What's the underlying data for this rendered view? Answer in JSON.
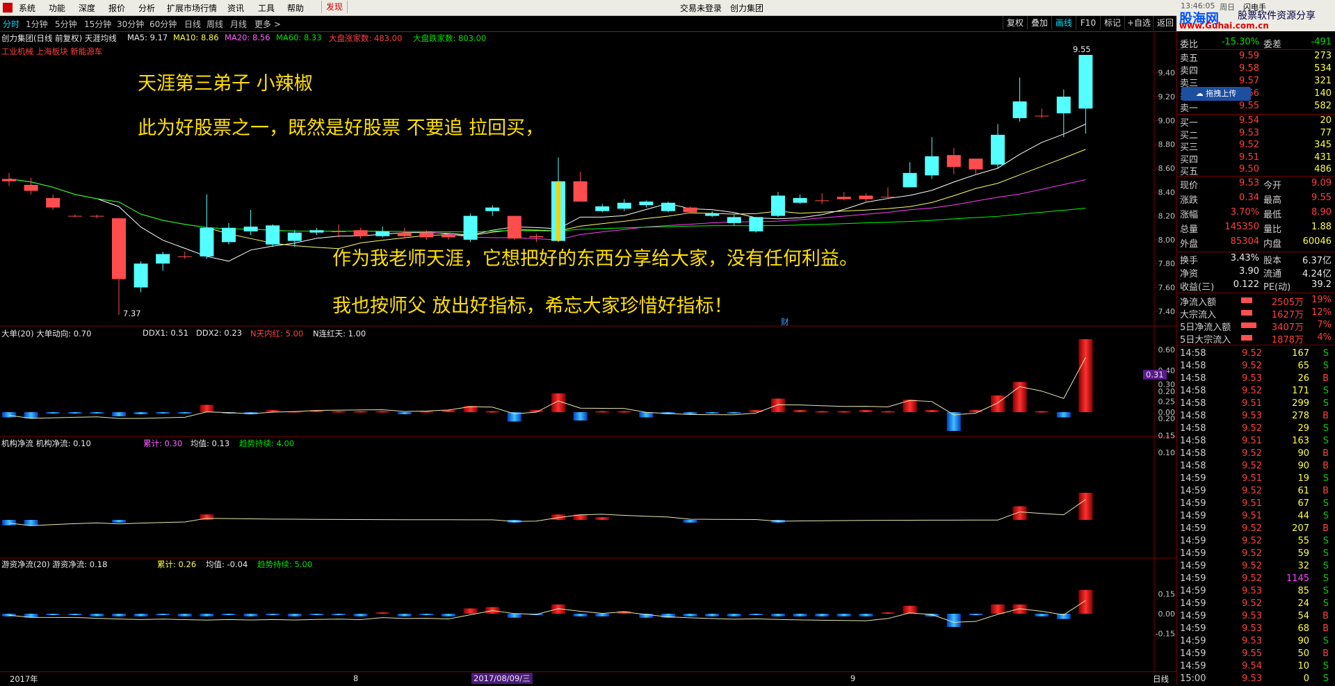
{
  "menu": [
    "系统",
    "功能",
    "深度",
    "报价",
    "分析",
    "扩展市场行情",
    "资讯",
    "工具",
    "帮助",
    "发现"
  ],
  "header_center": [
    "交易未登录",
    "创力集团"
  ],
  "header_right": {
    "time": "13:46:05",
    "week": "周日",
    "flash": "闪电手"
  },
  "logo": {
    "brand": "股海网",
    "slogan": "股票软件资源分享",
    "url": "www.Guhai.com.cn",
    "upload": "拖拽上传"
  },
  "periods": [
    "分时",
    "1分钟",
    "5分钟",
    "15分钟",
    "30分钟",
    "60分钟",
    "日线",
    "周线",
    "月线",
    "更多 >"
  ],
  "toolbar": [
    "复权",
    "叠加",
    "画线",
    "F10",
    "标记",
    "+自选",
    "返回"
  ],
  "main_legend": {
    "title": "创力集团(日线 前复权) 天涯均线",
    "ma5": "MA5: 9.17",
    "ma10": "MA10: 8.86",
    "ma20": "MA20: 8.56",
    "ma60": "MA60: 8.33",
    "up": "大盘涨家数: 483.00",
    "down": "大盘跌家数: 803.00",
    "sector": "工业机械 上海板块 新能源车"
  },
  "annotations": [
    "天涯第三弟子 小辣椒",
    "此为好股票之一，既然是好股票 不要追 拉回买，",
    "作为我老师天涯，它想把好的东西分享给大家，没有任何利益。",
    "我也按师父 放出好指标，希忘大家珍惜好指标！"
  ],
  "price_axis": [
    "9.40",
    "9.20",
    "9.00",
    "8.80",
    "8.60",
    "8.40",
    "8.20",
    "8.00",
    "7.80",
    "7.60",
    "7.40"
  ],
  "high_label": "9.55",
  "low_label": "7.37",
  "cai_marker": "财",
  "pane2": {
    "title": "大单(20) 大单动向: 0.70",
    "ddx1": "DDX1: 0.51",
    "ddx2": "DDX2: 0.23",
    "n1": "N天内红: 5.00",
    "n2": "N连红天: 1.00",
    "axis": [
      "0.60",
      "0.40",
      "0.20",
      "0.00"
    ],
    "tag": "0.31"
  },
  "pane3": {
    "title": "机构净流 机构净流: 0.10",
    "sum": "累计: 0.30",
    "avg": "均值: 0.13",
    "trend": "趋势持续: 4.00",
    "axis": [
      "0.30",
      "0.25",
      "0.20",
      "0.15",
      "0.10"
    ]
  },
  "pane4": {
    "title": "游资净流(20) 游资净流: 0.18",
    "sum": "累计: 0.26",
    "avg": "均值: -0.04",
    "trend": "趋势持续: 5.00",
    "axis": [
      "0.15",
      "0.00",
      "-0.15"
    ]
  },
  "date_axis": {
    "left": "2017年",
    "m8": "8",
    "cursor": "2017/08/09/三",
    "m9": "9",
    "mode": "日线"
  },
  "colors": {
    "up": "#ff4d4d",
    "down": "#54ffff",
    "ma5": "#ffffff",
    "ma10": "#ffff60",
    "ma20": "#ff40ff",
    "ma60": "#00ff00",
    "frame": "#7a0000"
  },
  "chart_data": {
    "type": "candlestick",
    "candles": [
      [
        8.49,
        8.51,
        8.56,
        8.45
      ],
      [
        8.41,
        8.46,
        8.52,
        8.38
      ],
      [
        8.27,
        8.35,
        8.38,
        8.25
      ],
      [
        8.2,
        8.2,
        8.21,
        8.19
      ],
      [
        8.2,
        8.2,
        8.21,
        8.18
      ],
      [
        7.67,
        8.18,
        8.18,
        7.37
      ],
      [
        7.8,
        7.6,
        7.82,
        7.56
      ],
      [
        7.88,
        7.8,
        7.9,
        7.74
      ],
      [
        7.86,
        7.86,
        7.9,
        7.84
      ],
      [
        8.1,
        7.86,
        8.38,
        7.84
      ],
      [
        8.1,
        7.98,
        8.14,
        7.96
      ],
      [
        8.11,
        8.07,
        8.25,
        8.04
      ],
      [
        8.12,
        7.96,
        8.13,
        7.94
      ],
      [
        8.06,
        7.99,
        8.08,
        7.94
      ],
      [
        8.08,
        8.06,
        8.1,
        8.04
      ],
      [
        8.07,
        8.07,
        8.13,
        8.02
      ],
      [
        8.03,
        8.08,
        8.1,
        8.01
      ],
      [
        8.07,
        8.03,
        8.11,
        8.02
      ],
      [
        8.03,
        8.06,
        8.1,
        8.01
      ],
      [
        8.02,
        8.06,
        8.08,
        8.0
      ],
      [
        8.02,
        8.04,
        8.05,
        8.0
      ],
      [
        8.2,
        8.0,
        8.22,
        7.98
      ],
      [
        8.27,
        8.24,
        8.29,
        8.2
      ],
      [
        8.01,
        8.2,
        8.2,
        8.0
      ],
      [
        8.02,
        8.03,
        8.05,
        7.98
      ],
      [
        8.49,
        7.99,
        8.69,
        7.98
      ],
      [
        8.32,
        8.49,
        8.57,
        8.32
      ],
      [
        8.28,
        8.24,
        8.3,
        8.23
      ],
      [
        8.31,
        8.26,
        8.34,
        8.24
      ],
      [
        8.32,
        8.29,
        8.33,
        8.27
      ],
      [
        8.31,
        8.24,
        8.32,
        8.23
      ],
      [
        8.23,
        8.27,
        8.28,
        8.22
      ],
      [
        8.22,
        8.2,
        8.24,
        8.19
      ],
      [
        8.19,
        8.14,
        8.21,
        8.12
      ],
      [
        8.19,
        8.07,
        8.19,
        8.06
      ],
      [
        8.37,
        8.2,
        8.4,
        8.19
      ],
      [
        8.35,
        8.31,
        8.38,
        8.3
      ],
      [
        8.33,
        8.33,
        8.39,
        8.3
      ],
      [
        8.34,
        8.36,
        8.4,
        8.33
      ],
      [
        8.34,
        8.37,
        8.39,
        8.31
      ],
      [
        8.36,
        8.36,
        8.44,
        8.34
      ],
      [
        8.56,
        8.44,
        8.65,
        8.44
      ],
      [
        8.7,
        8.54,
        8.86,
        8.51
      ],
      [
        8.61,
        8.71,
        8.77,
        8.55
      ],
      [
        8.59,
        8.68,
        8.68,
        8.54
      ],
      [
        8.88,
        8.63,
        8.97,
        8.6
      ],
      [
        9.16,
        9.02,
        9.36,
        8.99
      ],
      [
        9.04,
        9.04,
        9.1,
        9.02
      ],
      [
        9.2,
        9.06,
        9.26,
        8.86
      ],
      [
        9.55,
        9.1,
        9.55,
        8.89
      ]
    ],
    "ylim": [
      7.3,
      9.62
    ],
    "pane2_bars": [
      -0.05,
      -0.06,
      -0.01,
      -0.01,
      -0.01,
      -0.04,
      -0.02,
      -0.01,
      -0.01,
      0.07,
      -0.01,
      -0.02,
      0.02,
      0.01,
      0.02,
      0.01,
      0.01,
      0.01,
      -0.02,
      0.01,
      0.02,
      0.06,
      0.01,
      -0.09,
      0.02,
      0.18,
      -0.08,
      0.01,
      0.01,
      -0.05,
      -0.02,
      -0.02,
      -0.01,
      -0.01,
      0.02,
      0.13,
      0.02,
      0.01,
      0.01,
      0.02,
      0.01,
      0.12,
      0.02,
      -0.18,
      0.02,
      0.16,
      0.29,
      0.01,
      -0.05,
      0.7
    ],
    "pane3_bars": [
      -0.02,
      -0.02,
      0,
      0,
      0,
      -0.01,
      0,
      0,
      0,
      0.02,
      0,
      0,
      0,
      0,
      0,
      0,
      0,
      0,
      0,
      0,
      0,
      0,
      0,
      -0.01,
      0,
      0.02,
      0.02,
      0.01,
      0,
      0,
      0,
      -0.01,
      0,
      0,
      0,
      -0.01,
      0,
      0,
      0,
      0,
      0,
      0,
      0,
      0,
      0,
      0,
      0.05,
      0,
      0,
      0.1
    ],
    "pane4_bars": [
      -0.02,
      -0.03,
      -0.01,
      -0.01,
      -0.02,
      -0.02,
      -0.02,
      -0.01,
      -0.02,
      -0.02,
      -0.01,
      -0.02,
      -0.01,
      -0.02,
      -0.01,
      -0.01,
      -0.02,
      0.01,
      -0.02,
      -0.01,
      -0.02,
      0.04,
      0.05,
      -0.03,
      -0.01,
      0.07,
      -0.02,
      -0.02,
      0.02,
      -0.03,
      -0.03,
      -0.02,
      -0.02,
      -0.02,
      -0.01,
      -0.02,
      -0.02,
      -0.02,
      -0.02,
      -0.02,
      0.01,
      0.06,
      -0.02,
      -0.1,
      -0.01,
      0.07,
      0.07,
      -0.02,
      -0.04,
      0.18
    ]
  },
  "quote": {
    "top": {
      "k1": "委比",
      "v1": "-15.30%",
      "k2": "委差",
      "v2": "-491"
    },
    "asks": [
      [
        "卖五",
        "9.59",
        "273"
      ],
      [
        "卖四",
        "9.58",
        "534"
      ],
      [
        "卖三",
        "9.57",
        "321"
      ],
      [
        "卖二",
        "9.56",
        "140"
      ],
      [
        "卖一",
        "9.55",
        "582"
      ]
    ],
    "bids": [
      [
        "买一",
        "9.54",
        "20"
      ],
      [
        "买二",
        "9.53",
        "77"
      ],
      [
        "买三",
        "9.52",
        "345"
      ],
      [
        "买四",
        "9.51",
        "431"
      ],
      [
        "买五",
        "9.50",
        "486"
      ]
    ],
    "stats": [
      [
        "现价",
        "9.53",
        "今开",
        "9.09"
      ],
      [
        "涨跌",
        "0.34",
        "最高",
        "9.55"
      ],
      [
        "涨幅",
        "3.70%",
        "最低",
        "8.90"
      ],
      [
        "总量",
        "145350",
        "量比",
        "1.88"
      ],
      [
        "外盘",
        "85304",
        "内盘",
        "60046"
      ]
    ],
    "stats2": [
      [
        "换手",
        "3.43%",
        "股本",
        "6.37亿"
      ],
      [
        "净资",
        "3.90",
        "流通",
        "4.24亿"
      ],
      [
        "收益(三)",
        "0.122",
        "PE(动)",
        "39.2"
      ]
    ],
    "flows": [
      [
        "净流入额",
        "2505万",
        "19%"
      ],
      [
        "大宗流入",
        "1627万",
        "12%"
      ],
      [
        "5日净流入额",
        "3407万",
        "7%"
      ],
      [
        "5日大宗流入",
        "1878万",
        "4%"
      ]
    ],
    "ticks": [
      [
        "14:58",
        "9.52",
        "167",
        "S"
      ],
      [
        "14:58",
        "9.52",
        "65",
        "S"
      ],
      [
        "14:58",
        "9.53",
        "26",
        "B"
      ],
      [
        "14:58",
        "9.52",
        "171",
        "S"
      ],
      [
        "14:58",
        "9.51",
        "299",
        "S"
      ],
      [
        "14:58",
        "9.53",
        "278",
        "B"
      ],
      [
        "14:58",
        "9.52",
        "29",
        "S"
      ],
      [
        "14:58",
        "9.51",
        "163",
        "S"
      ],
      [
        "14:58",
        "9.52",
        "90",
        "B"
      ],
      [
        "14:58",
        "9.52",
        "90",
        "B"
      ],
      [
        "14:59",
        "9.51",
        "19",
        "S"
      ],
      [
        "14:59",
        "9.52",
        "61",
        "B"
      ],
      [
        "14:59",
        "9.51",
        "67",
        "S"
      ],
      [
        "14:59",
        "9.51",
        "44",
        "S"
      ],
      [
        "14:59",
        "9.52",
        "207",
        "B"
      ],
      [
        "14:59",
        "9.52",
        "55",
        "S"
      ],
      [
        "14:59",
        "9.52",
        "59",
        "S"
      ],
      [
        "14:59",
        "9.52",
        "32",
        "S"
      ],
      [
        "14:59",
        "9.52",
        "1145",
        "S"
      ],
      [
        "14:59",
        "9.53",
        "85",
        "S"
      ],
      [
        "14:59",
        "9.52",
        "24",
        "S"
      ],
      [
        "14:59",
        "9.53",
        "54",
        "B"
      ],
      [
        "14:59",
        "9.53",
        "68",
        "B"
      ],
      [
        "14:59",
        "9.53",
        "90",
        "S"
      ],
      [
        "14:59",
        "9.55",
        "50",
        "B"
      ],
      [
        "14:59",
        "9.54",
        "10",
        "S"
      ],
      [
        "15:00",
        "9.53",
        "0",
        "S"
      ]
    ]
  }
}
